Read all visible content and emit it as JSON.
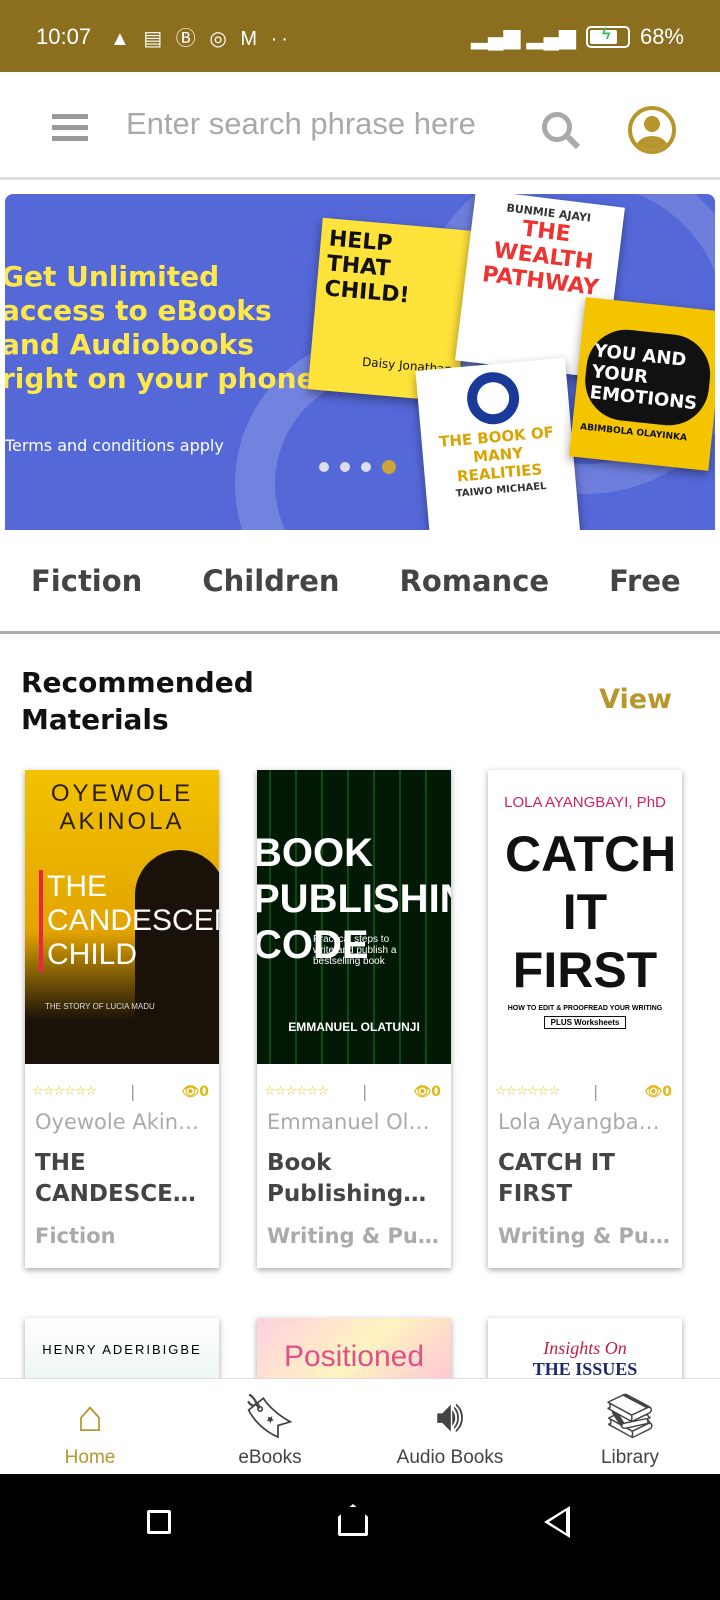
{
  "status_bar": {
    "time": "10:07",
    "notification_icons": "▲ ▤ Ⓑ ◎ M ··",
    "battery": "68%"
  },
  "header": {
    "search_placeholder": "Enter search phrase here"
  },
  "banner": {
    "headline": "Get Unlimited\naccess to eBooks\nand Audiobooks\nright on your phone.",
    "terms": "Terms and conditions apply",
    "slide_count": 4,
    "active_slide": 4,
    "books": [
      {
        "title": "HELP THAT CHILD!",
        "author": "Daisy Jonathan"
      },
      {
        "title": "THE WEALTH PATHWAY",
        "author": "BUNMIE AJAYI"
      },
      {
        "title": "THE BOOK OF MANY REALITIES",
        "author": "TAIWO MICHAEL"
      },
      {
        "title": "YOU AND YOUR EMOTIONS",
        "author": "ABIMBOLA OLAYINKA"
      }
    ]
  },
  "tabs": [
    "Fiction",
    "Children",
    "Romance",
    "Free"
  ],
  "section": {
    "title": "Recommended Materials",
    "view_label": "View"
  },
  "books": [
    {
      "cover_author": "OYEWOLE AKINOLA",
      "cover_title": "THE CANDESCENT CHILD",
      "cover_sub": "THE STORY OF LUCIA MADU",
      "stars": "☆☆☆☆☆☆",
      "views": "0",
      "author": "Oyewole Akinola",
      "title": "THE CANDESCENT CHILD",
      "category": "Fiction"
    },
    {
      "cover_title": "BOOK PUBLISHING CODE",
      "cover_sub": "Practical steps to write and publish a bestselling book",
      "cover_author": "EMMANUEL OLATUNJI",
      "stars": "☆☆☆☆☆☆",
      "views": "0",
      "author": "Emmanuel Olatunji",
      "title": "Book Publishing Code",
      "category": "Writing & Publishing"
    },
    {
      "cover_author": "LOLA AYANGBAYI, PhD",
      "cover_title": "CATCH IT FIRST",
      "cover_sub": "HOW TO EDIT & PROOFREAD YOUR WRITING",
      "cover_badge": "PLUS Worksheets",
      "stars": "☆☆☆☆☆☆",
      "views": "0",
      "author": "Lola Ayangbayi, PhD",
      "title": "CATCH IT FIRST",
      "category": "Writing & Publishing"
    }
  ],
  "books_row2": [
    {
      "cover_text": "HENRY ADERIBIGBE"
    },
    {
      "cover_text": "Positioned"
    },
    {
      "cover_text": "Insights On",
      "cover_text2": "THE ISSUES"
    }
  ],
  "bottom_nav": [
    {
      "label": "Home",
      "icon": "home-icon",
      "active": true
    },
    {
      "label": "eBooks",
      "icon": "bookmark-icon"
    },
    {
      "label": "Audio Books",
      "icon": "speaker-icon"
    },
    {
      "label": "Library",
      "icon": "library-icon"
    }
  ],
  "colors": {
    "accent": "#b8962e",
    "status_bar": "#8b6f1f",
    "banner": "#5468d8",
    "headline": "#ffe94a"
  }
}
